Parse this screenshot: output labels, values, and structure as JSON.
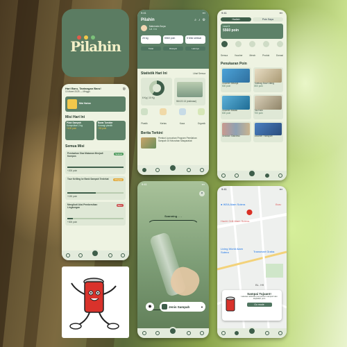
{
  "logo": {
    "text": "Pilahin"
  },
  "screen_home": {
    "time": "9:41",
    "brand": "Pilahin",
    "user_name": "Mahendra Surya",
    "user_sub": "Lvl. 4 ★",
    "stats": [
      {
        "value": "20 kg"
      },
      {
        "value": "5560 poin"
      },
      {
        "value": "5 Misi selesai"
      }
    ],
    "actions": [
      "Tukar",
      "Riwayat",
      "Lainnya"
    ],
    "section_stats": "Statistik Hari Ini",
    "see_all": "Lihat Semua",
    "chart_label": "6 Kg | 10 Kg",
    "emission_label": "58.022.13 (estimasi)",
    "categories": [
      "Plastik",
      "Kertas",
      "Kaca",
      "Organik"
    ],
    "section_news": "Berita Terkini",
    "news_title": "Pemkot Luncurkan Program Pemilahan Sampah Di Kelurahan Masyarakat"
  },
  "screen_points": {
    "time": "9:41",
    "tabs": [
      "Hadiah",
      "Poin Saya"
    ],
    "level": "Level 5",
    "points": "5560 poin",
    "chips": [
      "Semua",
      "Voucher",
      "Merch",
      "Produk",
      "Donasi"
    ],
    "section": "Penukaran Poin",
    "items": [
      {
        "title": "Voucher Belanja",
        "cost": "500 poin"
      },
      {
        "title": "Totebag Daur Ulang",
        "cost": "800 poin"
      },
      {
        "title": "Voucher Makan",
        "cost": "600 poin"
      },
      {
        "title": "Tas Kain",
        "cost": "700 poin"
      },
      {
        "title": "Sedotan Stainless",
        "cost": "400 poin"
      },
      {
        "title": "Voucher Transport",
        "cost": "500 poin"
      }
    ]
  },
  "screen_mission": {
    "time": "9:41",
    "greeting": "Hari Baru, Tantangan Baru!",
    "date": "10 Maret 2025 — Minggu",
    "banner_title": "Misi Harian",
    "section_daily": "Misi Hari Ini",
    "daily": [
      {
        "title": "Pilah Sampah",
        "sub": "Kumpulkan 2 kg",
        "reward": "+100 poin"
      },
      {
        "title": "Bawa Tumbler",
        "sub": "Kurangi plastik",
        "reward": "+50 poin"
      }
    ],
    "section_all": "Semua Misi",
    "missions": [
      {
        "title": "Pemisahan Sisa Makanan Menjadi Kompos",
        "status": "Selesai",
        "status_color": "#4f9b5e",
        "reward": "+200 poin"
      },
      {
        "title": "Tour Keliling ke Bank Sampah Terdekat",
        "status": "Progres",
        "status_color": "#e0a93b",
        "reward": "+150 poin"
      },
      {
        "title": "Mengikuti Aksi Pembersihan Lingkungan",
        "status": "Baru",
        "status_color": "#c94a4a",
        "reward": "+300 poin"
      }
    ]
  },
  "screen_scan": {
    "time": "9:41",
    "scanning": "Scanning . . .",
    "type_label": "Jenis Sampah"
  },
  "screen_map": {
    "time": "9:41",
    "places": [
      "IKEA Alam Sutera",
      "Hachi Grill Alam Sutera",
      "Living World Alam Sutera",
      "Transmart Graha",
      "Brav",
      "BL. H9"
    ],
    "popup_title": "Sampai Tujuan!!",
    "popup_text": "Lakukan aktivitas penyetoran sampah dan dapatkan poin",
    "popup_button": "Go mode"
  },
  "colors": {
    "primary": "#5d8168",
    "dark": "#3e5e4a",
    "light": "#eef3e2"
  }
}
